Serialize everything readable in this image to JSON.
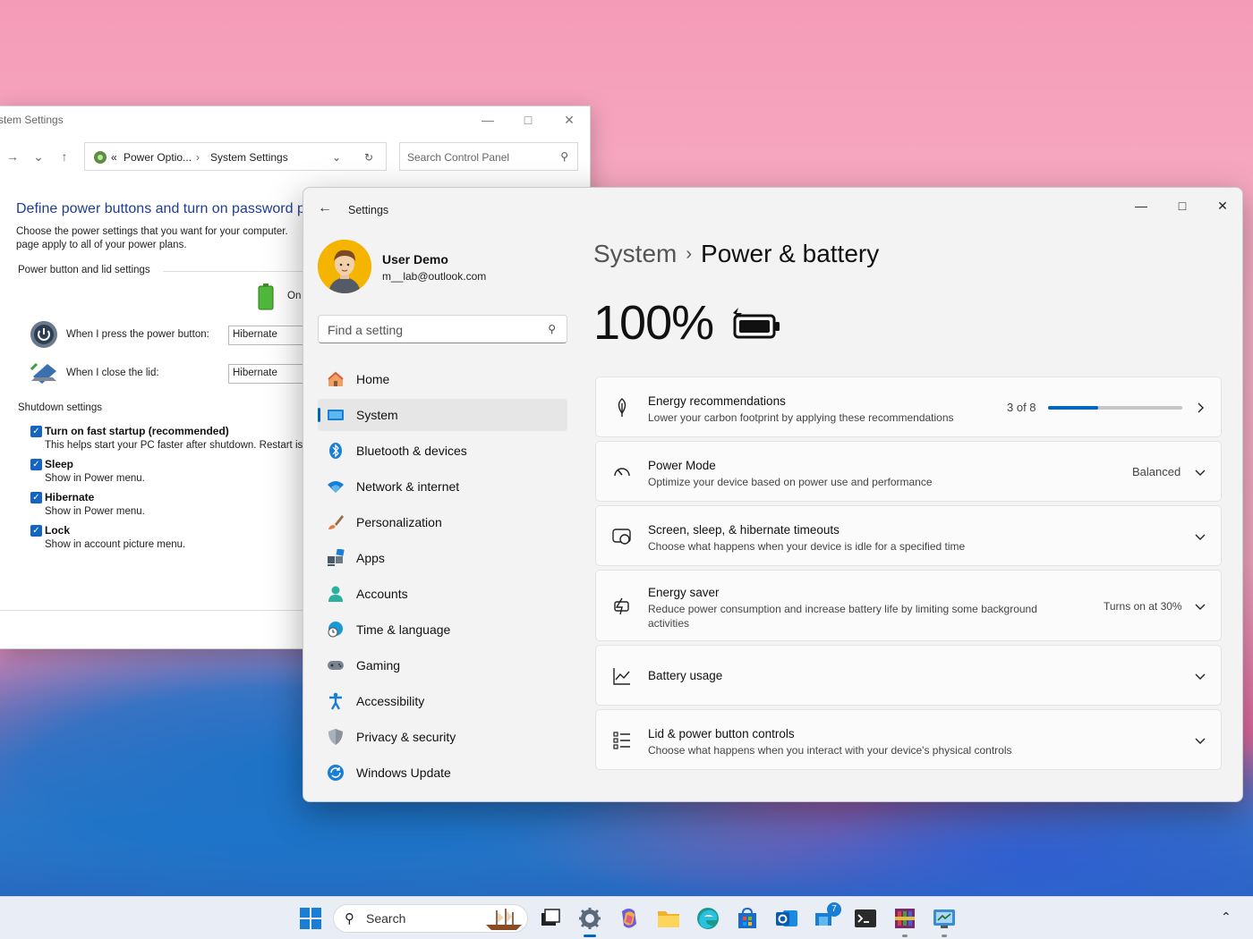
{
  "control_panel": {
    "window_title": "stem Settings",
    "address": {
      "prefix": "«",
      "crumb1": "Power Optio...",
      "crumb2": "System Settings"
    },
    "search_placeholder": "Search Control Panel",
    "heading": "Define power buttons and turn on password p",
    "description": "Choose the power settings that you want for your computer. page apply to all of your power plans.",
    "section_lid": "Power button and lid settings",
    "on_battery_label": "On",
    "power_button_label": "When I press the power button:",
    "power_button_value": "Hibernate",
    "lid_label": "When I close the lid:",
    "lid_value": "Hibernate",
    "section_shutdown": "Shutdown settings",
    "options": [
      {
        "label": "Turn on fast startup (recommended)",
        "sub": "This helps start your PC faster after shutdown. Restart is"
      },
      {
        "label": "Sleep",
        "sub": "Show in Power menu."
      },
      {
        "label": "Hibernate",
        "sub": "Show in Power menu."
      },
      {
        "label": "Lock",
        "sub": "Show in account picture menu."
      }
    ]
  },
  "settings": {
    "app_title": "Settings",
    "profile": {
      "name": "User Demo",
      "email": "m__lab@outlook.com"
    },
    "find_placeholder": "Find a setting",
    "nav": [
      {
        "label": "Home",
        "icon": "home-icon"
      },
      {
        "label": "System",
        "icon": "system-icon",
        "active": true
      },
      {
        "label": "Bluetooth & devices",
        "icon": "bluetooth-icon"
      },
      {
        "label": "Network & internet",
        "icon": "wifi-icon"
      },
      {
        "label": "Personalization",
        "icon": "brush-icon"
      },
      {
        "label": "Apps",
        "icon": "apps-icon"
      },
      {
        "label": "Accounts",
        "icon": "person-icon"
      },
      {
        "label": "Time & language",
        "icon": "globe-clock-icon"
      },
      {
        "label": "Gaming",
        "icon": "gamepad-icon"
      },
      {
        "label": "Accessibility",
        "icon": "accessibility-icon"
      },
      {
        "label": "Privacy & security",
        "icon": "shield-icon"
      },
      {
        "label": "Windows Update",
        "icon": "update-icon"
      }
    ],
    "breadcrumb": {
      "parent": "System",
      "current": "Power & battery"
    },
    "battery_percent": "100%",
    "cards": [
      {
        "title": "Energy recommendations",
        "sub": "Lower your carbon footprint by applying these recommendations",
        "right": "3 of 8",
        "progress": 0.375
      },
      {
        "title": "Power Mode",
        "sub": "Optimize your device based on power use and performance",
        "right": "Balanced"
      },
      {
        "title": "Screen, sleep, & hibernate timeouts",
        "sub": "Choose what happens when your device is idle for a specified time"
      },
      {
        "title": "Energy saver",
        "sub": "Reduce power consumption and increase battery life by limiting some background activities",
        "right": "Turns on at 30%"
      },
      {
        "title": "Battery usage"
      },
      {
        "title": "Lid & power button controls",
        "sub": "Choose what happens when you interact with your device's physical controls"
      }
    ]
  },
  "taskbar": {
    "search_placeholder": "Search",
    "badge_count": "7"
  },
  "colors": {
    "accent": "#0067c0",
    "avatar_bg": "#f5b400",
    "link_blue": "#1e3f8f"
  }
}
